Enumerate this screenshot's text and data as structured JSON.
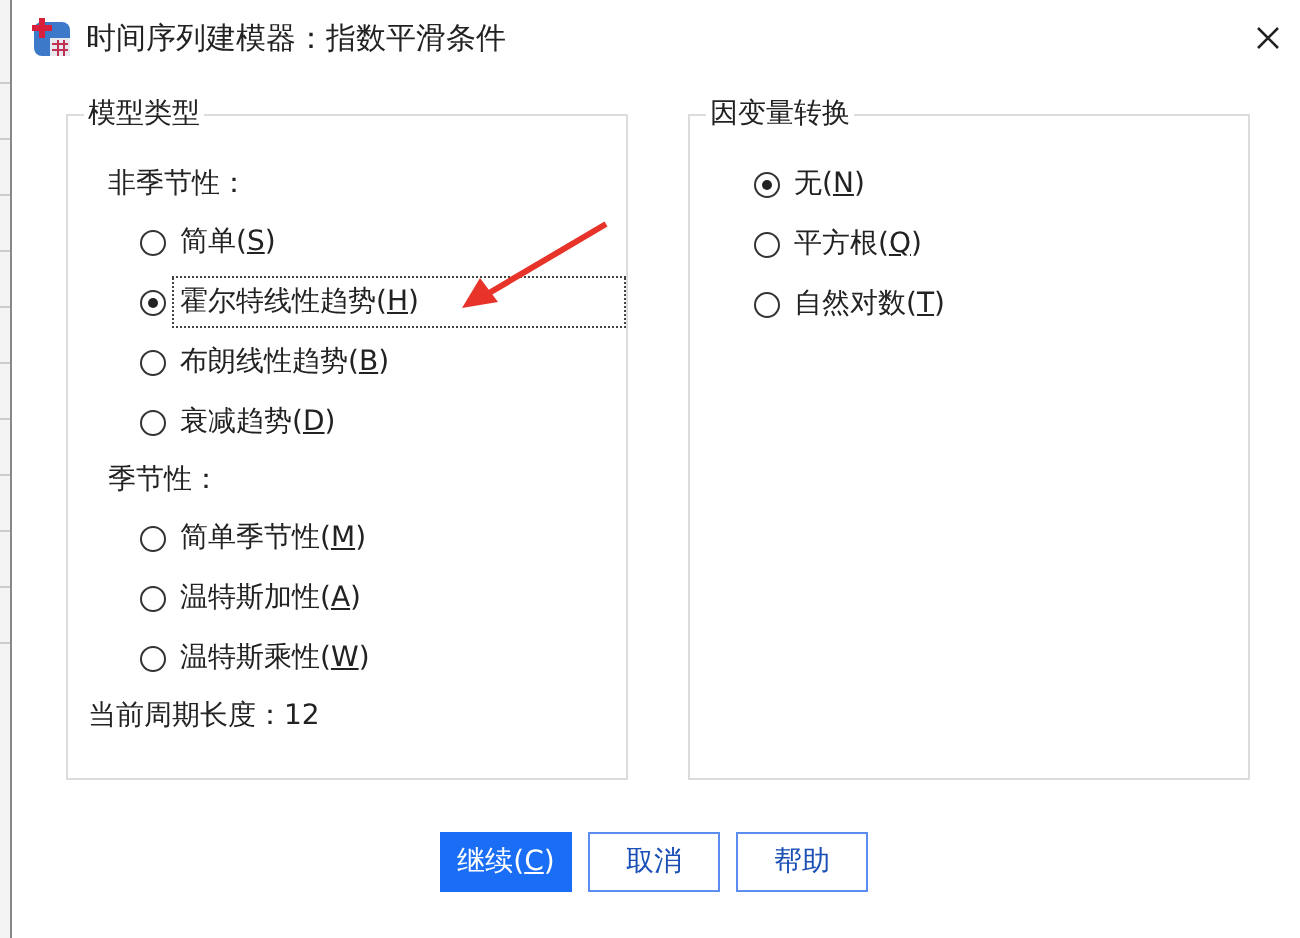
{
  "window": {
    "title": "时间序列建模器：指数平滑条件"
  },
  "model_type": {
    "title": "模型类型",
    "groups": [
      {
        "heading": "非季节性：",
        "options": [
          {
            "label": "简单(S)",
            "selected": false,
            "focused": false
          },
          {
            "label": "霍尔特线性趋势(H)",
            "selected": true,
            "focused": true
          },
          {
            "label": "布朗线性趋势(B)",
            "selected": false,
            "focused": false
          },
          {
            "label": "衰减趋势(D)",
            "selected": false,
            "focused": false
          }
        ]
      },
      {
        "heading": "季节性：",
        "options": [
          {
            "label": "简单季节性(M)",
            "selected": false,
            "focused": false
          },
          {
            "label": "温特斯加性(A)",
            "selected": false,
            "focused": false
          },
          {
            "label": "温特斯乘性(W)",
            "selected": false,
            "focused": false
          }
        ]
      }
    ],
    "period": "当前周期长度：12"
  },
  "transformation": {
    "title": "因变量转换",
    "options": [
      {
        "label": "无(N)",
        "selected": true
      },
      {
        "label": "平方根(Q)",
        "selected": false
      },
      {
        "label": "自然对数(T)",
        "selected": false
      }
    ]
  },
  "buttons": [
    {
      "label": "继续(C)",
      "default": true
    },
    {
      "label": "取消",
      "default": false
    },
    {
      "label": "帮助",
      "default": false
    }
  ]
}
